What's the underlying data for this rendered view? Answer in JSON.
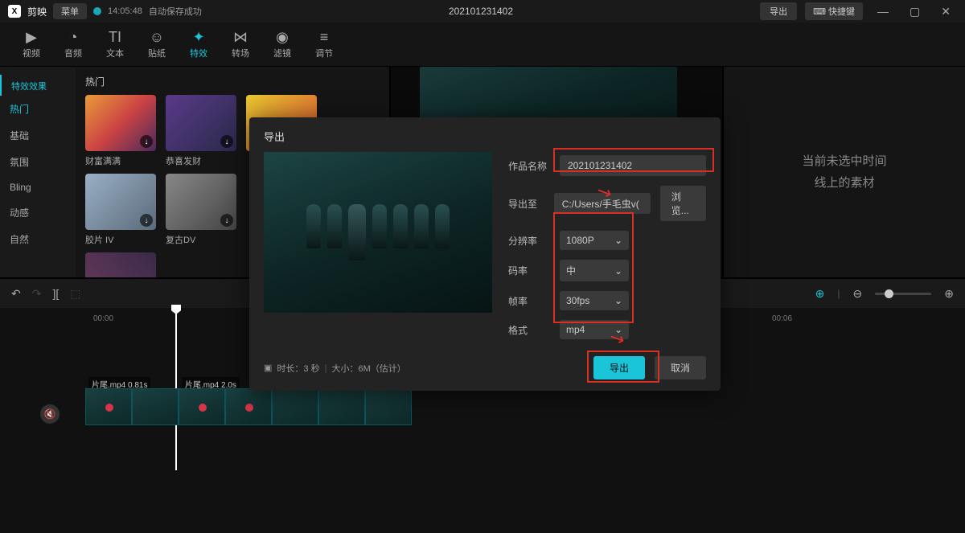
{
  "app": {
    "name": "剪映",
    "menu": "菜单",
    "save_time": "14:05:48",
    "save_msg": "自动保存成功"
  },
  "title_center": "202101231402",
  "titlebar": {
    "export": "导出",
    "shortcut": "快捷键"
  },
  "top_tabs": [
    {
      "label": "视频",
      "icon": "▶"
    },
    {
      "label": "音频",
      "icon": "◔"
    },
    {
      "label": "文本",
      "icon": "TI"
    },
    {
      "label": "贴纸",
      "icon": "☺"
    },
    {
      "label": "特效",
      "icon": "✦"
    },
    {
      "label": "转场",
      "icon": "⋈"
    },
    {
      "label": "滤镜",
      "icon": "◉"
    },
    {
      "label": "调节",
      "icon": "≡"
    }
  ],
  "cat_header": "特效效果",
  "categories": [
    "热门",
    "基础",
    "氛围",
    "Bling",
    "动感",
    "自然"
  ],
  "effects_section": "热门",
  "effects_row1": [
    {
      "name": "财富满满"
    },
    {
      "name": "恭喜发财"
    },
    {
      "name": ""
    }
  ],
  "effects_row2": [
    {
      "name": "胶片 IV"
    },
    {
      "name": "复古DV"
    }
  ],
  "right_msg_line1": "当前未选中时间",
  "right_msg_line2": "线上的素材",
  "timeline": {
    "t0": "00:00",
    "t6": "00:06",
    "clip1": "片尾.mp4  0.81s",
    "clip2": "片尾.mp4  2.0s"
  },
  "dialog": {
    "title": "导出",
    "label_name": "作品名称",
    "name_value": "202101231402",
    "label_path": "导出至",
    "path_value": "C:/Users/手毛虫v(・u",
    "browse": "浏览...",
    "label_res": "分辨率",
    "res_value": "1080P",
    "label_bitrate": "码率",
    "bitrate_value": "中",
    "label_fps": "帧率",
    "fps_value": "30fps",
    "label_format": "格式",
    "format_value": "mp4",
    "info_duration": "时长：3 秒",
    "info_size": "大小：6M（估计）",
    "export_btn": "导出",
    "cancel_btn": "取消"
  }
}
